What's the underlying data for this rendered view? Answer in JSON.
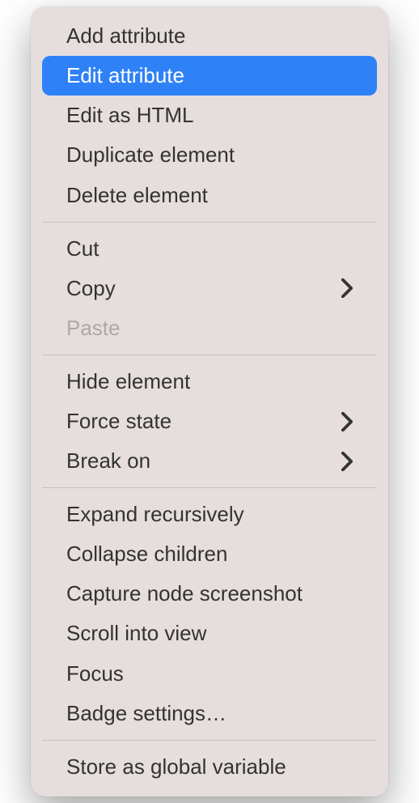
{
  "menu": {
    "groups": [
      [
        {
          "id": "add-attribute",
          "label": "Add attribute",
          "selected": false,
          "disabled": false,
          "submenu": false
        },
        {
          "id": "edit-attribute",
          "label": "Edit attribute",
          "selected": true,
          "disabled": false,
          "submenu": false
        },
        {
          "id": "edit-as-html",
          "label": "Edit as HTML",
          "selected": false,
          "disabled": false,
          "submenu": false
        },
        {
          "id": "duplicate-element",
          "label": "Duplicate element",
          "selected": false,
          "disabled": false,
          "submenu": false
        },
        {
          "id": "delete-element",
          "label": "Delete element",
          "selected": false,
          "disabled": false,
          "submenu": false
        }
      ],
      [
        {
          "id": "cut",
          "label": "Cut",
          "selected": false,
          "disabled": false,
          "submenu": false
        },
        {
          "id": "copy",
          "label": "Copy",
          "selected": false,
          "disabled": false,
          "submenu": true
        },
        {
          "id": "paste",
          "label": "Paste",
          "selected": false,
          "disabled": true,
          "submenu": false
        }
      ],
      [
        {
          "id": "hide-element",
          "label": "Hide element",
          "selected": false,
          "disabled": false,
          "submenu": false
        },
        {
          "id": "force-state",
          "label": "Force state",
          "selected": false,
          "disabled": false,
          "submenu": true
        },
        {
          "id": "break-on",
          "label": "Break on",
          "selected": false,
          "disabled": false,
          "submenu": true
        }
      ],
      [
        {
          "id": "expand-recursively",
          "label": "Expand recursively",
          "selected": false,
          "disabled": false,
          "submenu": false
        },
        {
          "id": "collapse-children",
          "label": "Collapse children",
          "selected": false,
          "disabled": false,
          "submenu": false
        },
        {
          "id": "capture-node-screenshot",
          "label": "Capture node screenshot",
          "selected": false,
          "disabled": false,
          "submenu": false
        },
        {
          "id": "scroll-into-view",
          "label": "Scroll into view",
          "selected": false,
          "disabled": false,
          "submenu": false
        },
        {
          "id": "focus",
          "label": "Focus",
          "selected": false,
          "disabled": false,
          "submenu": false
        },
        {
          "id": "badge-settings",
          "label": "Badge settings…",
          "selected": false,
          "disabled": false,
          "submenu": false
        }
      ],
      [
        {
          "id": "store-as-global-variable",
          "label": "Store as global variable",
          "selected": false,
          "disabled": false,
          "submenu": false
        }
      ]
    ]
  },
  "colors": {
    "menu_bg": "#e5dedd",
    "selected_bg": "#2f81f7",
    "text": "#333333",
    "disabled_text": "#b0a8a7",
    "separator": "#c8c0bf"
  }
}
